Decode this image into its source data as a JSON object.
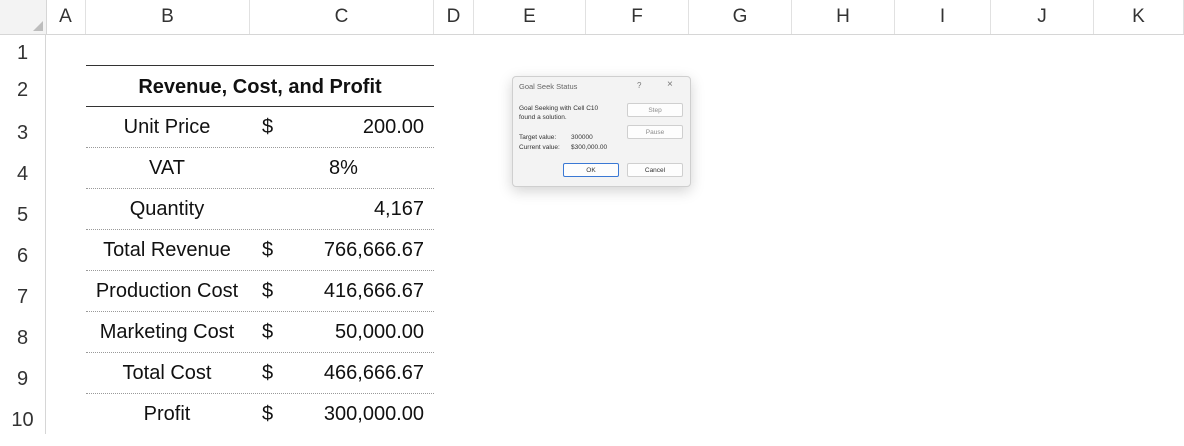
{
  "columns": [
    "A",
    "B",
    "C",
    "D",
    "E",
    "F",
    "G",
    "H",
    "I",
    "J",
    "K"
  ],
  "rows": [
    "1",
    "2",
    "3",
    "4",
    "5",
    "6",
    "7",
    "8",
    "9",
    "10"
  ],
  "table": {
    "title": "Revenue, Cost, and Profit",
    "items": [
      {
        "label": "Unit Price",
        "currency": "$",
        "value": "200.00"
      },
      {
        "label": "VAT",
        "currency": "",
        "value": "8%"
      },
      {
        "label": "Quantity",
        "currency": "",
        "value": "4,167"
      },
      {
        "label": "Total Revenue",
        "currency": "$",
        "value": "766,666.67"
      },
      {
        "label": "Production Cost",
        "currency": "$",
        "value": "416,666.67"
      },
      {
        "label": "Marketing Cost",
        "currency": "$",
        "value": "50,000.00"
      },
      {
        "label": "Total Cost",
        "currency": "$",
        "value": "466,666.67"
      },
      {
        "label": "Profit",
        "currency": "$",
        "value": "300,000.00"
      }
    ]
  },
  "dialog": {
    "title": "Goal Seek Status",
    "help": "?",
    "close": "×",
    "message_line1": "Goal Seeking with Cell C10",
    "message_line2": "found a solution.",
    "target_label": "Target value:",
    "target_value": "300000",
    "current_label": "Current value:",
    "current_value": "$300,000.00",
    "buttons": {
      "step": "Step",
      "pause": "Pause",
      "ok": "OK",
      "cancel": "Cancel"
    }
  }
}
